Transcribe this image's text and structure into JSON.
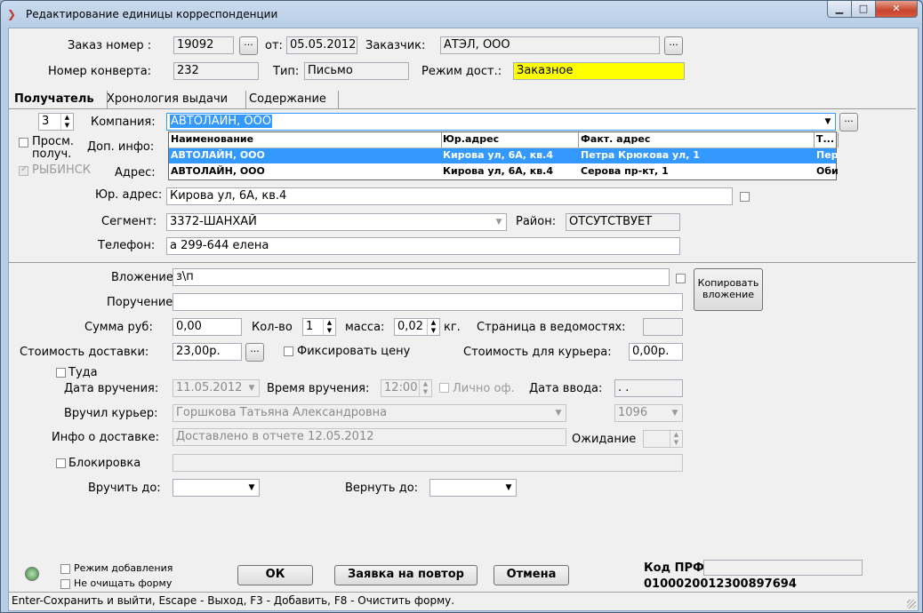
{
  "window": {
    "title": "Редактирование единицы корреспонденции",
    "btn_min": "▁",
    "btn_max": "□",
    "btn_close": "✕"
  },
  "header": {
    "order_label": "Заказ номер :",
    "order_value": "19092",
    "order_btn": "...",
    "from_label": "от:",
    "from_value": "05.05.2012",
    "client_label": "Заказчик:",
    "client_value": "АТЭЛ, ООО",
    "client_btn": "...",
    "envelope_label": "Номер конверта:",
    "envelope_value": "232",
    "type_label": "Тип:",
    "type_value": "Письмо",
    "mode_label": "Режим дост.:",
    "mode_value": "Заказное",
    "mode_color": "#ffff00"
  },
  "tabs": [
    {
      "label": "Получатель",
      "active": true
    },
    {
      "label": "Хронология выдачи"
    },
    {
      "label": "Содержание"
    }
  ],
  "recipient": {
    "count_value": "3",
    "company_label": "Компания:",
    "company_value": "АВТОЛАЙН, ООО",
    "company_btn": "...",
    "view_recv_label_1": "Просм.",
    "view_recv_label_2": "получ.",
    "city_label": "РЫБИНСК",
    "extra_label": "Доп. инфо:",
    "address_label": "Адрес:",
    "legal_addr_label": "Юр. адрес:",
    "legal_addr_value": "Кирова ул, 6А, кв.4",
    "segment_label": "Сегмент:",
    "segment_value": "3372-ШАНХАЙ",
    "district_label": "Район:",
    "district_value": "ОТСУТСТВУЕТ",
    "phone_label": "Телефон:",
    "phone_value": "а 299-644 елена"
  },
  "company_dropdown": {
    "columns": [
      "Наименование",
      "Юр.адрес",
      "Факт. адрес",
      "Т..."
    ],
    "rows": [
      {
        "name": "АВТОЛАЙН, ООО",
        "legal": "Кирова ул, 6А, кв.4",
        "fact": "Петра Крюкова ул, 1",
        "t": "Пер",
        "selected": true
      },
      {
        "name": "АВТОЛАЙН, ООО",
        "legal": "Кирова ул, 6А, кв.4",
        "fact": "Серова пр-кт, 1",
        "t": "Оби",
        "selected": false
      }
    ]
  },
  "contents": {
    "attachment_label": "Вложение:",
    "attachment_value": "з\\п",
    "copy_btn_1": "Копировать",
    "copy_btn_2": "вложение",
    "errand_label": "Поручение:",
    "errand_value": "",
    "sum_label": "Сумма руб:",
    "sum_value": "0,00",
    "qty_label": "Кол-во",
    "qty_value": "1",
    "mass_label": "масса:",
    "mass_value": "0,02",
    "mass_unit": "кг.",
    "page_label": "Страница в ведомостях:",
    "page_value": "",
    "cost_label": "Стоимость доставки:",
    "cost_value": "23,00р.",
    "cost_btn": "...",
    "fix_price_label": "Фиксировать цену",
    "courier_cost_label": "Стоимость для курьера:",
    "courier_cost_value": "0,00р."
  },
  "delivery": {
    "there_label": "Туда",
    "date_label": "Дата вручения:",
    "date_value": "11.05.2012",
    "time_label": "Время вручения:",
    "time_value": "12:00",
    "personal_label": "Лично оф.",
    "entry_date_label": "Дата ввода:",
    "entry_date_value": " .  .",
    "courier_label": "Вручил курьер:",
    "courier_value": "Горшкова Татьяна Александровна",
    "courier_code": "1096",
    "info_label": "Инфо о доставке:",
    "info_value": "Доставлено в отчете 12.05.2012",
    "wait_label": "Ожидание",
    "wait_value": "",
    "block_label": "Блокировка",
    "block_value": "",
    "hand_until_label": "Вручить до:",
    "hand_until_value": "",
    "return_until_label": "Вернуть до:",
    "return_until_value": ""
  },
  "footer": {
    "add_mode_label": "Режим добавления",
    "no_clear_label": "Не очищать форму",
    "ok_btn": "ОК",
    "repeat_btn": "Заявка на повтор",
    "cancel_btn": "Отмена",
    "prf_label": "Код ПРФ",
    "prf_value": "",
    "prf_code": "0100020012300897694"
  },
  "status_bar": {
    "text": "Enter-Сохранить и выйти, Escape - Выход, F3 - Добавить, F8 - Очистить форму."
  },
  "icons": {
    "app": "app-logo-icon",
    "refresh": "refresh-icon"
  }
}
